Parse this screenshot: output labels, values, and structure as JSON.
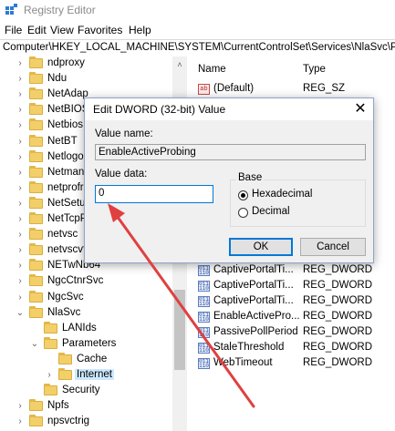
{
  "window": {
    "title": "Registry Editor",
    "app_icon": "registry-icon"
  },
  "menu": [
    "File",
    "Edit",
    "View",
    "Favorites",
    "Help"
  ],
  "address": "Computer\\HKEY_LOCAL_MACHINE\\SYSTEM\\CurrentControlSet\\Services\\NlaSvc\\Par",
  "tree": [
    {
      "label": "ndproxy"
    },
    {
      "label": "Ndu"
    },
    {
      "label": "NetAdap"
    },
    {
      "label": "NetBIOS"
    },
    {
      "label": "Netbios"
    },
    {
      "label": "NetBT"
    },
    {
      "label": "Netlogo"
    },
    {
      "label": "Netman"
    },
    {
      "label": "netprofr"
    },
    {
      "label": "NetSetup"
    },
    {
      "label": "NetTcpP"
    },
    {
      "label": "netvsc"
    },
    {
      "label": "netvscvf"
    },
    {
      "label": "NETwNb64"
    },
    {
      "label": "NgcCtnrSvc"
    },
    {
      "label": "NgcSvc"
    },
    {
      "label": "NlaSvc"
    },
    {
      "label": "LANIds"
    },
    {
      "label": "Parameters"
    },
    {
      "label": "Cache"
    },
    {
      "label": "Internet"
    },
    {
      "label": "Security"
    },
    {
      "label": "Npfs"
    },
    {
      "label": "npsvctrig"
    }
  ],
  "values_pane": {
    "headers": {
      "name": "Name",
      "type": "Type"
    },
    "rows": [
      {
        "name": "(Default)",
        "type": "REG_SZ",
        "icon": "string-value-icon"
      },
      {
        "name": "CaptivePortalTi...",
        "type": "REG_DWORD",
        "icon": "dword-value-icon"
      },
      {
        "name": "CaptivePortalTi...",
        "type": "REG_DWORD",
        "icon": "dword-value-icon"
      },
      {
        "name": "CaptivePortalTi...",
        "type": "REG_DWORD",
        "icon": "dword-value-icon"
      },
      {
        "name": "EnableActivePro...",
        "type": "REG_DWORD",
        "icon": "dword-value-icon"
      },
      {
        "name": "PassivePollPeriod",
        "type": "REG_DWORD",
        "icon": "dword-value-icon"
      },
      {
        "name": "StaleThreshold",
        "type": "REG_DWORD",
        "icon": "dword-value-icon"
      },
      {
        "name": "WebTimeout",
        "type": "REG_DWORD",
        "icon": "dword-value-icon"
      }
    ]
  },
  "dialog": {
    "title": "Edit DWORD (32-bit) Value",
    "value_name_label": "Value name:",
    "value_name": "EnableActiveProbing",
    "value_data_label": "Value data:",
    "value_data": "0",
    "base_label": "Base",
    "base_options": [
      "Hexadecimal",
      "Decimal"
    ],
    "base_selected": "Hexadecimal",
    "ok_label": "OK",
    "cancel_label": "Cancel"
  },
  "colors": {
    "annotation_arrow": "#e04040",
    "selection": "#cce8ff",
    "focus": "#0078d7"
  }
}
